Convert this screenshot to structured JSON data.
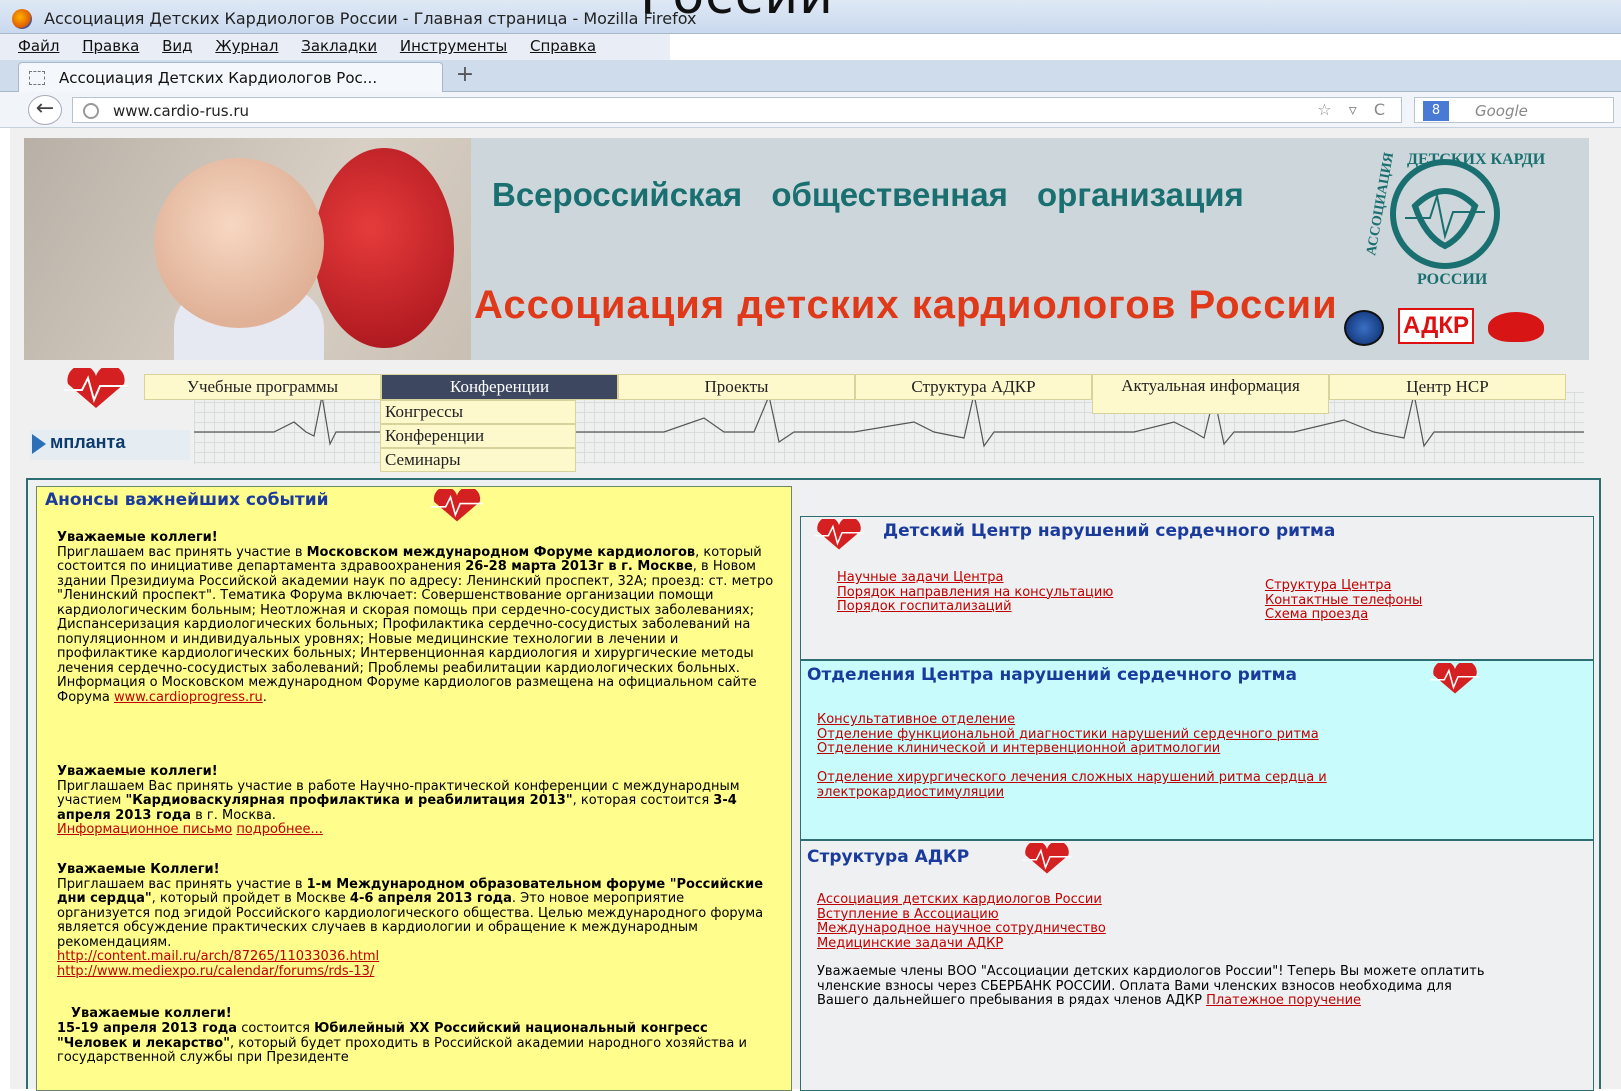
{
  "overlay_title": "России",
  "browser": {
    "window_title": "Ассоциация Детских Кардиологов России - Главная страница - Mozilla Firefox",
    "menu": [
      "Файл",
      "Правка",
      "Вид",
      "Журнал",
      "Закладки",
      "Инструменты",
      "Справка"
    ],
    "tab_title": "Ассоциация Детских Кардиологов Рос...",
    "new_tab": "+",
    "url": "www.cardio-rus.ru",
    "search_placeholder": "Google",
    "search_engine_badge": "8"
  },
  "header": {
    "line1": "Всероссийская общественная организация",
    "line2": "Ассоциация детских кардиологов России",
    "logo_top": "ДЕТСКИХ КАРДИОЛОГОВ",
    "logo_left": "АССОЦИАЦИЯ",
    "logo_bottom": "РОССИИ",
    "adkr_button": "АДКР"
  },
  "nav": {
    "sponsor": "мпланта",
    "items": [
      "Учебные программы",
      "Конференции",
      "Проекты",
      "Структура АДКР",
      "Актуальная информация",
      "Центр НСР"
    ],
    "submenu": [
      "Конгрессы",
      "Конференции",
      "Семинары"
    ]
  },
  "announcements": {
    "title": "Анонсы важнейших событий",
    "p1_title": "Уважаемые коллеги!",
    "p1_a": "Приглашаем вас принять участие в ",
    "p1_b": "Московском международном Форуме кардиологов",
    "p1_c": ", который состоится по инициативе департамента здравоохранения ",
    "p1_d": "26-28 марта 2013г в г. Москве",
    "p1_e": ", в Новом здании Президиума Российской академии наук по адресу: Ленинский проспект, 32А; проезд: ст. метро \"Ленинский проспект\". Тематика Форума включает: Совершенствование организации помощи кардиологическим больным; Неотложная и скорая помощь при сердечно-сосудистых заболеваниях; Диспансеризация кардиологических больных; Профилактика сердечно-сосудистых заболеваний на популяционном и индивидуальных уровнях; Новые медицинские технологии в лечении и профилактике кардиологических больных; Интервенционная кардиология и хирургические методы лечения сердечно-сосудистых заболеваний; Проблемы реабилитации кардиологических больных.",
    "p1_f": "Информация о Московском международном Форуме кардиологов размещена на официальном сайте Форума ",
    "p1_link": "www.cardioprogress.ru",
    "p2_title": "Уважаемые коллеги!",
    "p2_a": "Приглашаем Вас принять участие в работе Научно-практической конференции с международным участием ",
    "p2_b": "\"Кардиоваскулярная профилактика и реабилитация 2013\"",
    "p2_c": ", которая состоится ",
    "p2_d": "3-4 апреля 2013 года",
    "p2_e": " в г. Москва.",
    "p2_link1": "Информационное письмо",
    "p2_link2": "подробнее...",
    "p3_title": "Уважаемые Коллеги!",
    "p3_a": "Приглашаем вас принять участие в ",
    "p3_b": "1-м Международном образовательном форуме \"Российские дни сердца\"",
    "p3_c": ", который пройдет в Москве ",
    "p3_d": "4-6 апреля 2013 года",
    "p3_e": ". Это новое мероприятие организуется под эгидой Российского кардиологического общества. Целью международного форума является обсуждение практических случаев в кардиологии и обращение к международным рекомендациям.",
    "p3_link1": "http://content.mail.ru/arch/87265/11033036.html",
    "p3_link2": "http://www.mediexpo.ru/calendar/forums/rds-13/",
    "p4_title": "Уважаемые коллеги!",
    "p4_a": "15-19 апреля 2013 года",
    "p4_b": " состоится ",
    "p4_c": "Юбилейный XX Российский национальный конгресс \"Человек и лекарство\"",
    "p4_d": ", который будет проходить в Российской академии народного хозяйства и государственной службы при Президенте"
  },
  "center": {
    "title": "Детский Центр нарушений сердечного ритма",
    "links_left": [
      "Научные задачи Центра",
      "Порядок направления на консультацию",
      "Порядок госпитализаций"
    ],
    "links_right": [
      "Структура Центра",
      "Контактные телефоны",
      "Схема проезда"
    ]
  },
  "departments": {
    "title": "Отделения Центра нарушений сердечного ритма",
    "links": [
      "Консультативное отделение",
      "Отделение функциональной диагностики нарушений сердечного ритма",
      "Отделение клинической и интервенционной аритмологии"
    ],
    "link4": "Отделение хирургического лечения сложных нарушений ритма сердца и электрокардиостимуляции"
  },
  "structure": {
    "title": "Структура АДКР",
    "links": [
      "Ассоциация детских кардиологов России",
      "Вступление в Ассоциацию",
      "Международное научное сотрудничество",
      "Медицинские задачи АДКР"
    ],
    "note": "Уважаемые члены ВОО \"Ассоциации детских кардиологов России\"! Теперь Вы можете оплатить членские взносы через СБЕРБАНК РОССИИ. Оплата Вами членских взносов необходима для Вашего дальнейшего пребывания в рядах членов АДКР ",
    "note_link": "Платежное поручение"
  },
  "colors": {
    "accent_teal": "#1a7070",
    "accent_red": "#e0391a",
    "link": "#c00000",
    "heading_blue": "#1a3b9c",
    "announce_bg": "#fffd8c",
    "dept_bg": "#c8fbfb"
  }
}
